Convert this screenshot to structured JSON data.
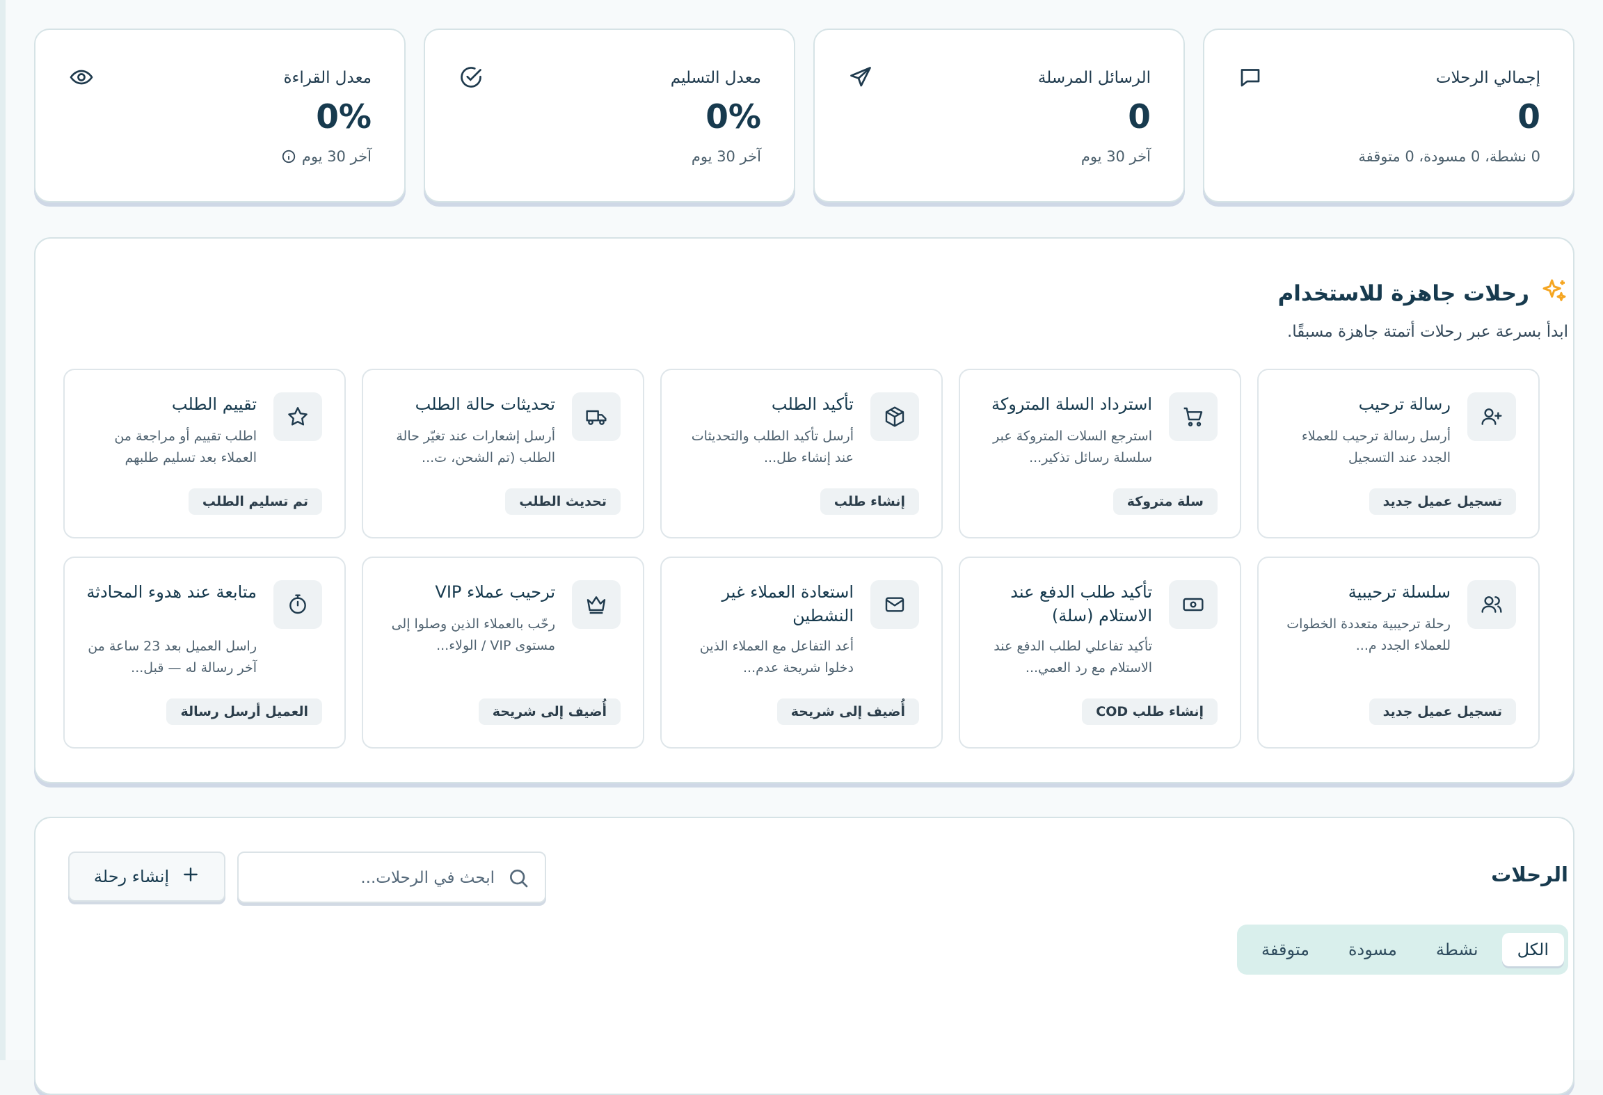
{
  "stats": [
    {
      "label": "إجمالي الرحلات",
      "value": "0",
      "sub": "0 نشطة، 0 مسودة، 0 متوقفة",
      "icon": "chat-bubble-icon"
    },
    {
      "label": "الرسائل المرسلة",
      "value": "0",
      "sub": "آخر 30 يوم",
      "icon": "send-icon"
    },
    {
      "label": "معدل التسليم",
      "value": "0%",
      "sub": "آخر 30 يوم",
      "icon": "check-circle-icon"
    },
    {
      "label": "معدل القراءة",
      "value": "0%",
      "sub": "آخر 30 يوم",
      "icon": "eye-icon",
      "sub_icon": "info-icon"
    }
  ],
  "templates_section": {
    "title": "رحلات جاهزة للاستخدام",
    "subtitle": "ابدأ بسرعة عبر رحلات أتمتة جاهزة مسبقًا.",
    "icon": "sparkles-icon",
    "accent_color": "#f5a623"
  },
  "templates": [
    {
      "title": "رسالة ترحيب",
      "desc": "أرسل رسالة ترحيب للعملاء الجدد عند التسجيل",
      "trigger": "تسجيل عميل جديد",
      "icon": "user-plus-icon"
    },
    {
      "title": "استرداد السلة المتروكة",
      "desc": "استرجع السلات المتروكة عبر سلسلة رسائل تذكير...",
      "trigger": "سلة متروكة",
      "icon": "cart-icon"
    },
    {
      "title": "تأكيد الطلب",
      "desc": "أرسل تأكيد الطلب والتحديثات عند إنشاء طل...",
      "trigger": "إنشاء طلب",
      "icon": "package-icon"
    },
    {
      "title": "تحديثات حالة الطلب",
      "desc": "أرسل إشعارات عند تغيّر حالة الطلب (تم الشحن، ت...",
      "trigger": "تحديث الطلب",
      "icon": "truck-icon"
    },
    {
      "title": "تقييم الطلب",
      "desc": "اطلب تقييم أو مراجعة من العملاء بعد تسليم طلبهم",
      "trigger": "تم تسليم الطلب",
      "icon": "star-icon"
    },
    {
      "title": "سلسلة ترحيبية",
      "desc": "رحلة ترحيبية متعددة الخطوات للعملاء الجدد م...",
      "trigger": "تسجيل عميل جديد",
      "icon": "users-icon"
    },
    {
      "title": "تأكيد طلب الدفع عند الاستلام (سلة)",
      "desc": "تأكيد تفاعلي لطلب الدفع عند الاستلام مع رد العمي...",
      "trigger": "إنشاء طلب COD",
      "icon": "banknote-icon"
    },
    {
      "title": "استعادة العملاء غير النشطين",
      "desc": "أعد التفاعل مع العملاء الذين دخلوا شريحة عدم...",
      "trigger": "أُضيف إلى شريحة",
      "icon": "mail-icon"
    },
    {
      "title": "ترحيب عملاء VIP",
      "desc": "رحّب بالعملاء الذين وصلوا إلى مستوى VIP / الولاء...",
      "trigger": "أُضيف إلى شريحة",
      "icon": "crown-icon"
    },
    {
      "title": "متابعة عند هدوء المحادثة",
      "desc": "راسل العميل بعد 23 ساعة من آخر رسالة له — قبل...",
      "trigger": "العميل أرسل رسالة",
      "icon": "timer-icon"
    }
  ],
  "journeys": {
    "title": "الرحلات",
    "create_label": "إنشاء رحلة",
    "search_placeholder": "ابحث في الرحلات...",
    "search_value": "",
    "tabs": [
      "الكل",
      "نشطة",
      "مسودة",
      "متوقفة"
    ],
    "active_tab": "الكل"
  }
}
